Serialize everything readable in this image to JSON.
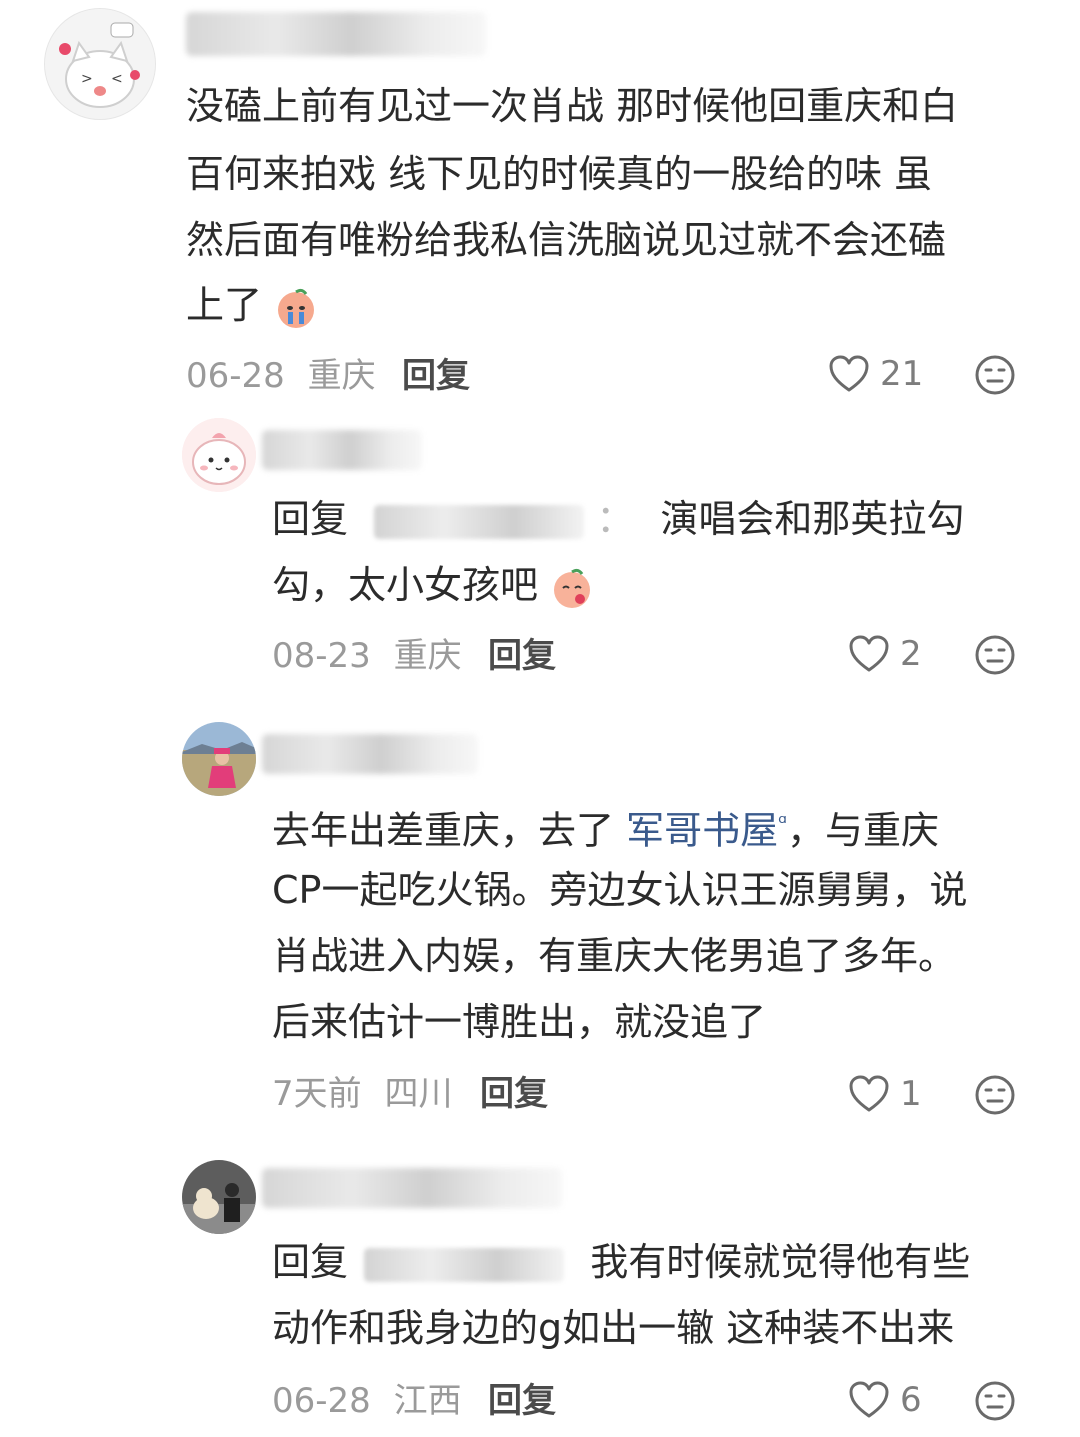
{
  "comments": [
    {
      "lines": [
        "没磕上前有见过一次肖战 那时候他回重庆和白",
        "百何来拍戏 线下见的时候真的一股给的味 虽",
        "然后面有唯粉给我私信洗脑说见过就不会还磕",
        "上了"
      ],
      "date": "06-28",
      "location": "重庆",
      "reply_label": "回复",
      "likes": "21"
    },
    {
      "reply_prefix": "回复",
      "reply_separator": "：",
      "lines_rest": "演唱会和那英拉勾",
      "line2": "勾，太小女孩吧",
      "date": "08-23",
      "location": "重庆",
      "reply_label": "回复",
      "likes": "2"
    },
    {
      "line1_a": "去年出差重庆，去了 ",
      "line1_link": "军哥书屋",
      "line1_search": "ᵅ",
      "line1_b": "，与重庆",
      "lines": [
        "CP一起吃火锅。旁边女认识王源舅舅，说",
        "肖战进入内娱，有重庆大佬男追了多年。",
        "后来估计一博胜出，就没追了"
      ],
      "date": "7天前",
      "location": "四川",
      "reply_label": "回复",
      "likes": "1"
    },
    {
      "reply_prefix": "回复",
      "line1_rest": "我有时候就觉得他有些",
      "line2": "动作和我身边的g如出一辙 这种装不出来",
      "date": "06-28",
      "location": "江西",
      "reply_label": "回复",
      "likes": "6"
    }
  ],
  "icons": {
    "like": "heart-outline-icon",
    "dislike": "frown-face-icon"
  },
  "colors": {
    "text": "#2b2b2b",
    "meta": "#9a9a9a",
    "link": "#3a5a8c"
  }
}
